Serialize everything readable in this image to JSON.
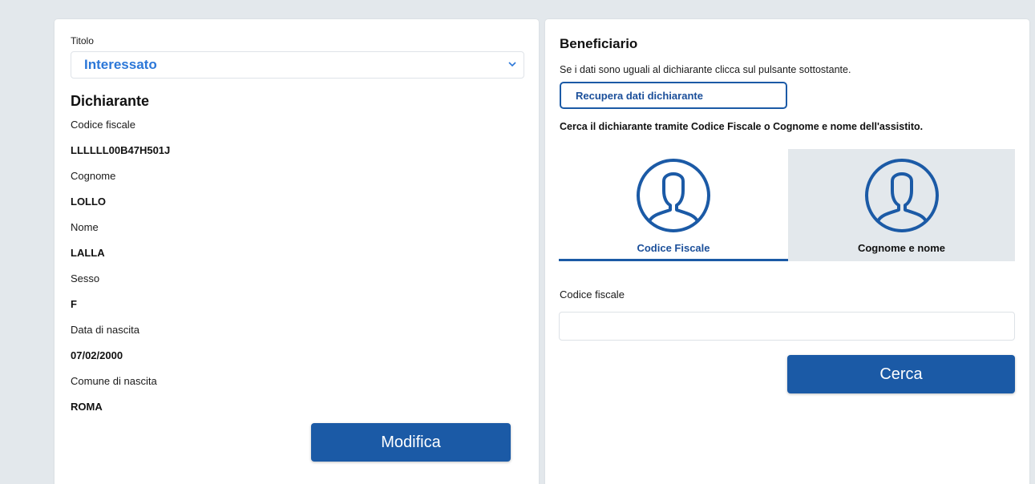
{
  "left": {
    "titolo_label": "Titolo",
    "titolo_value": "Interessato",
    "section_title": "Dichiarante",
    "fields": [
      {
        "label": "Codice fiscale",
        "value": "LLLLLL00B47H501J"
      },
      {
        "label": "Cognome",
        "value": "LOLLO"
      },
      {
        "label": "Nome",
        "value": "LALLA"
      },
      {
        "label": "Sesso",
        "value": "F"
      },
      {
        "label": "Data di nascita",
        "value": "07/02/2000"
      },
      {
        "label": "Comune di nascita",
        "value": "ROMA"
      }
    ],
    "modifica_label": "Modifica"
  },
  "right": {
    "section_title": "Beneficiario",
    "info_text": "Se i dati sono uguali al dichiarante clicca sul pulsante sottostante.",
    "recupera_label": "Recupera dati dichiarante",
    "search_hint": "Cerca il dichiarante tramite Codice Fiscale o Cognome e nome dell'assistito.",
    "tabs": [
      {
        "label": "Codice Fiscale",
        "icon": "person-circle-icon",
        "active": true
      },
      {
        "label": "Cognome e nome",
        "icon": "person-circle-icon",
        "active": false
      }
    ],
    "input_label": "Codice fiscale",
    "input_value": "",
    "cerca_label": "Cerca"
  },
  "colors": {
    "primary": "#1b5aa6",
    "accent_text": "#2b77d8",
    "background": "#e3e8ec"
  }
}
